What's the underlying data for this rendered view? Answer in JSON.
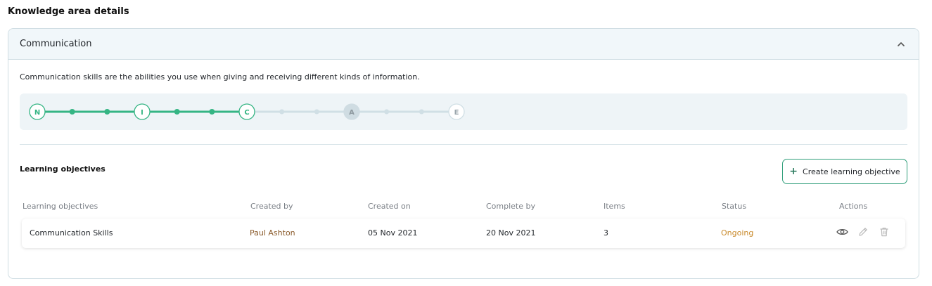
{
  "page_title": "Knowledge area details",
  "area": {
    "title": "Communication",
    "description": "Communication skills are the abilities you use when giving and receiving different kinds of information."
  },
  "stepper": {
    "levels": [
      {
        "label": "N",
        "state": "reached"
      },
      {
        "label": "I",
        "state": "reached"
      },
      {
        "label": "C",
        "state": "reached"
      },
      {
        "label": "A",
        "state": "target"
      },
      {
        "label": "E",
        "state": "pending"
      }
    ],
    "active_color": "#35b584",
    "inactive_color": "#d0dfe5"
  },
  "objectives": {
    "section_title": "Learning objectives",
    "create_button_label": "Create learning objective",
    "columns": [
      "Learning objectives",
      "Created by",
      "Created on",
      "Complete by",
      "Items",
      "Status",
      "Actions"
    ],
    "rows": [
      {
        "name": "Communication Skills",
        "created_by": "Paul Ashton",
        "created_on": "05 Nov 2021",
        "complete_by": "20 Nov 2021",
        "items": "3",
        "status": "Ongoing"
      }
    ]
  },
  "icons": {
    "collapse": "chevron-up-icon",
    "add": "plus-icon",
    "view": "eye-icon",
    "edit": "pencil-icon",
    "delete": "trash-icon"
  },
  "colors": {
    "accent": "#35b584",
    "border": "#cfdde3",
    "author": "#8a5a2a",
    "status_ongoing": "#c98a2c"
  }
}
